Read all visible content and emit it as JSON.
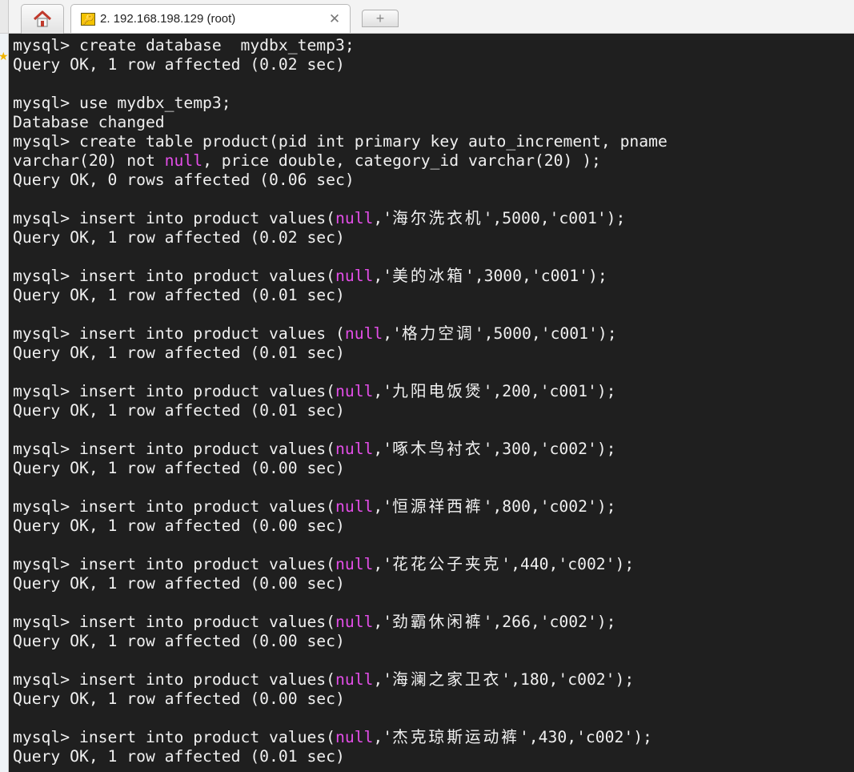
{
  "tabs": {
    "home_icon": "home-icon",
    "session": {
      "icon": "key-icon",
      "title": "2. 192.168.198.129 (root)",
      "close_glyph": "✕"
    },
    "new_tab_glyph": "+"
  },
  "colors": {
    "terminal_bg": "#1f1f1f",
    "terminal_fg": "#f0f0f0",
    "null_keyword": "#e34ee8"
  },
  "terminal": {
    "lines": [
      [
        {
          "t": "mysql> create database  mydbx_temp3;"
        }
      ],
      [
        {
          "t": "Query OK, 1 row affected (0.02 sec)"
        }
      ],
      [],
      [
        {
          "t": "mysql> use mydbx_temp3;"
        }
      ],
      [
        {
          "t": "Database changed"
        }
      ],
      [
        {
          "t": "mysql> create table product(pid int primary key auto_increment, pname"
        }
      ],
      [
        {
          "t": "varchar(20) not "
        },
        {
          "t": "null",
          "c": "kw-null"
        },
        {
          "t": ", price double, category_id varchar(20) );"
        }
      ],
      [
        {
          "t": "Query OK, 0 rows affected (0.06 sec)"
        }
      ],
      [],
      [
        {
          "t": "mysql> insert into product values("
        },
        {
          "t": "null",
          "c": "kw-null"
        },
        {
          "t": ",'"
        },
        {
          "t": "海尔洗衣机",
          "c": "cjk"
        },
        {
          "t": "',5000,'c001');"
        }
      ],
      [
        {
          "t": "Query OK, 1 row affected (0.02 sec)"
        }
      ],
      [],
      [
        {
          "t": "mysql> insert into product values("
        },
        {
          "t": "null",
          "c": "kw-null"
        },
        {
          "t": ",'"
        },
        {
          "t": "美的冰箱",
          "c": "cjk"
        },
        {
          "t": "',3000,'c001');"
        }
      ],
      [
        {
          "t": "Query OK, 1 row affected (0.01 sec)"
        }
      ],
      [],
      [
        {
          "t": "mysql> insert into product values ("
        },
        {
          "t": "null",
          "c": "kw-null"
        },
        {
          "t": ",'"
        },
        {
          "t": "格力空调",
          "c": "cjk"
        },
        {
          "t": "',5000,'c001');"
        }
      ],
      [
        {
          "t": "Query OK, 1 row affected (0.01 sec)"
        }
      ],
      [],
      [
        {
          "t": "mysql> insert into product values("
        },
        {
          "t": "null",
          "c": "kw-null"
        },
        {
          "t": ",'"
        },
        {
          "t": "九阳电饭煲",
          "c": "cjk"
        },
        {
          "t": "',200,'c001');"
        }
      ],
      [
        {
          "t": "Query OK, 1 row affected (0.01 sec)"
        }
      ],
      [],
      [
        {
          "t": "mysql> insert into product values("
        },
        {
          "t": "null",
          "c": "kw-null"
        },
        {
          "t": ",'"
        },
        {
          "t": "啄木鸟衬衣",
          "c": "cjk"
        },
        {
          "t": "',300,'c002');"
        }
      ],
      [
        {
          "t": "Query OK, 1 row affected (0.00 sec)"
        }
      ],
      [],
      [
        {
          "t": "mysql> insert into product values("
        },
        {
          "t": "null",
          "c": "kw-null"
        },
        {
          "t": ",'"
        },
        {
          "t": "恒源祥西裤",
          "c": "cjk"
        },
        {
          "t": "',800,'c002');"
        }
      ],
      [
        {
          "t": "Query OK, 1 row affected (0.00 sec)"
        }
      ],
      [],
      [
        {
          "t": "mysql> insert into product values("
        },
        {
          "t": "null",
          "c": "kw-null"
        },
        {
          "t": ",'"
        },
        {
          "t": "花花公子夹克",
          "c": "cjk"
        },
        {
          "t": "',440,'c002');"
        }
      ],
      [
        {
          "t": "Query OK, 1 row affected (0.00 sec)"
        }
      ],
      [],
      [
        {
          "t": "mysql> insert into product values("
        },
        {
          "t": "null",
          "c": "kw-null"
        },
        {
          "t": ",'"
        },
        {
          "t": "劲霸休闲裤",
          "c": "cjk"
        },
        {
          "t": "',266,'c002');"
        }
      ],
      [
        {
          "t": "Query OK, 1 row affected (0.00 sec)"
        }
      ],
      [],
      [
        {
          "t": "mysql> insert into product values("
        },
        {
          "t": "null",
          "c": "kw-null"
        },
        {
          "t": ",'"
        },
        {
          "t": "海澜之家卫衣",
          "c": "cjk"
        },
        {
          "t": "',180,'c002');"
        }
      ],
      [
        {
          "t": "Query OK, 1 row affected (0.00 sec)"
        }
      ],
      [],
      [
        {
          "t": "mysql> insert into product values("
        },
        {
          "t": "null",
          "c": "kw-null"
        },
        {
          "t": ",'"
        },
        {
          "t": "杰克琼斯运动裤",
          "c": "cjk"
        },
        {
          "t": "',430,'c002');"
        }
      ],
      [
        {
          "t": "Query OK, 1 row affected (0.01 sec)"
        }
      ]
    ]
  }
}
